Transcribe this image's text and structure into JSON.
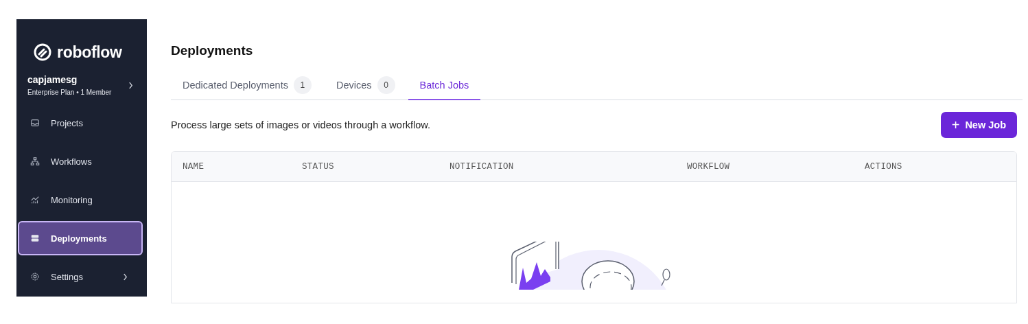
{
  "sidebar": {
    "logo": "roboflow",
    "account": {
      "name": "capjamesg",
      "plan": "Enterprise Plan • 1 Member"
    },
    "items": [
      {
        "label": "Projects",
        "kind": "inbox",
        "selected": false,
        "expandable": false
      },
      {
        "label": "Workflows",
        "kind": "hierarchy",
        "selected": false,
        "expandable": false
      },
      {
        "label": "Monitoring",
        "kind": "chart",
        "selected": false,
        "expandable": false
      },
      {
        "label": "Deployments",
        "kind": "server",
        "selected": true,
        "expandable": false
      },
      {
        "label": "Settings",
        "kind": "gear",
        "selected": false,
        "expandable": true
      }
    ]
  },
  "page": {
    "title": "Deployments",
    "tabs": [
      {
        "label": "Dedicated Deployments",
        "count": "1",
        "selected": false
      },
      {
        "label": "Devices",
        "count": "0",
        "selected": false
      },
      {
        "label": "Batch Jobs",
        "selected": true
      }
    ],
    "description": "Process large sets of images or videos through a workflow.",
    "new_button": {
      "icon": "+",
      "label": "New Job"
    },
    "table": {
      "columns": [
        "NAME",
        "STATUS",
        "NOTIFICATION",
        "WORKFLOW",
        "ACTIONS"
      ]
    }
  }
}
